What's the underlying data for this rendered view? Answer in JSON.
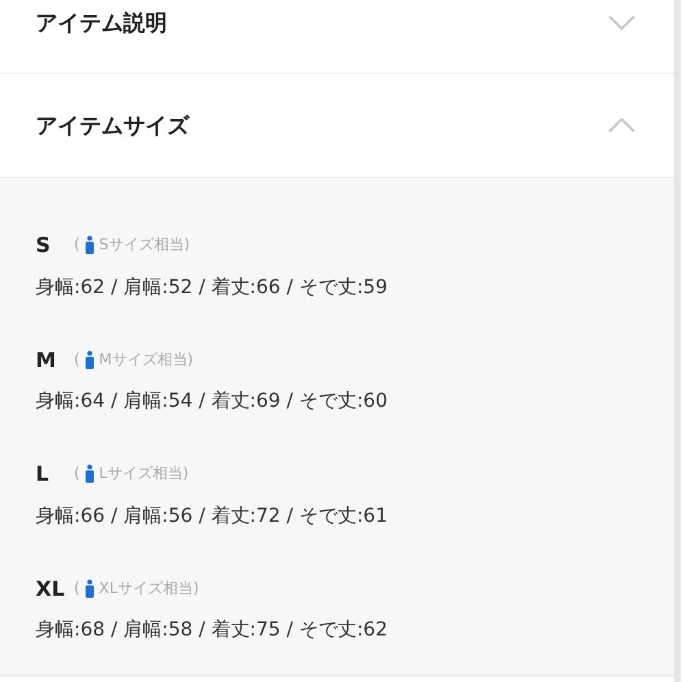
{
  "sections": [
    {
      "title": "アイテム説明",
      "expanded": false
    },
    {
      "title": "アイテムサイズ",
      "expanded": true
    }
  ],
  "sizes": [
    {
      "size": "S",
      "paren_open": "(",
      "equivalent": "Sサイズ相当)",
      "measurements": "身幅:62 / 肩幅:52 / 着丈:66 / そで丈:59"
    },
    {
      "size": "M",
      "paren_open": "(",
      "equivalent": "Mサイズ相当)",
      "measurements": "身幅:64 / 肩幅:54 / 着丈:69 / そで丈:60"
    },
    {
      "size": "L",
      "paren_open": "(",
      "equivalent": "Lサイズ相当)",
      "measurements": "身幅:66 / 肩幅:56 / 着丈:72 / そで丈:61"
    },
    {
      "size": "XL",
      "paren_open": "(",
      "equivalent": "XLサイズ相当)",
      "measurements": "身幅:68 / 肩幅:58 / 着丈:75 / そで丈:62"
    }
  ]
}
